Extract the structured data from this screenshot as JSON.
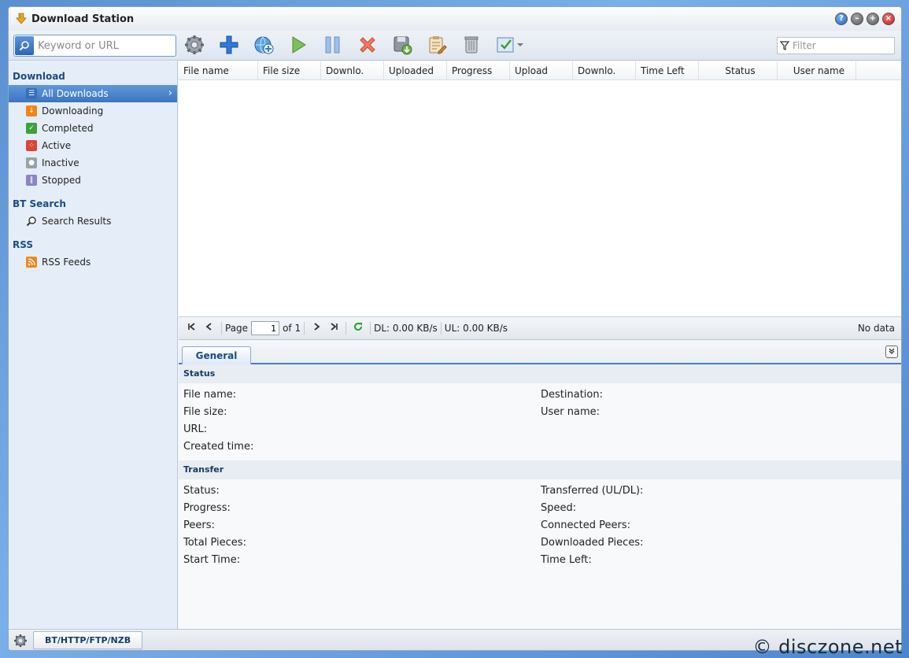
{
  "window": {
    "title": "Download Station"
  },
  "toolbar": {
    "search_placeholder": "Keyword or URL",
    "filter_placeholder": "Filter"
  },
  "sidebar": {
    "sections": [
      {
        "title": "Download",
        "items": [
          "All Downloads",
          "Downloading",
          "Completed",
          "Active",
          "Inactive",
          "Stopped"
        ]
      },
      {
        "title": "BT Search",
        "items": [
          "Search Results"
        ]
      },
      {
        "title": "RSS",
        "items": [
          "RSS Feeds"
        ]
      }
    ]
  },
  "grid": {
    "columns": [
      "File name",
      "File size",
      "Downlo.",
      "Uploaded",
      "Progress",
      "Upload",
      "Downlo.",
      "Time Left",
      "Status",
      "User name"
    ]
  },
  "pager": {
    "page_label": "Page",
    "page_value": "1",
    "of_label": "of 1",
    "dl_speed": "DL: 0.00 KB/s",
    "ul_speed": "UL: 0.00 KB/s",
    "status": "No data"
  },
  "details": {
    "tab": "General",
    "status_section": "Status",
    "status_left": [
      "File name:",
      "File size:",
      "URL:",
      "Created time:"
    ],
    "status_right": [
      "Destination:",
      "User name:"
    ],
    "transfer_section": "Transfer",
    "transfer_left": [
      "Status:",
      "Progress:",
      "Peers:",
      "Total Pieces:",
      "Start Time:"
    ],
    "transfer_right": [
      "Transferred (UL/DL):",
      "Speed:",
      "Connected Peers:",
      "Downloaded Pieces:",
      "Time Left:"
    ]
  },
  "bottom": {
    "tab": "BT/HTTP/FTP/NZB"
  },
  "watermark": "© disczone.net"
}
